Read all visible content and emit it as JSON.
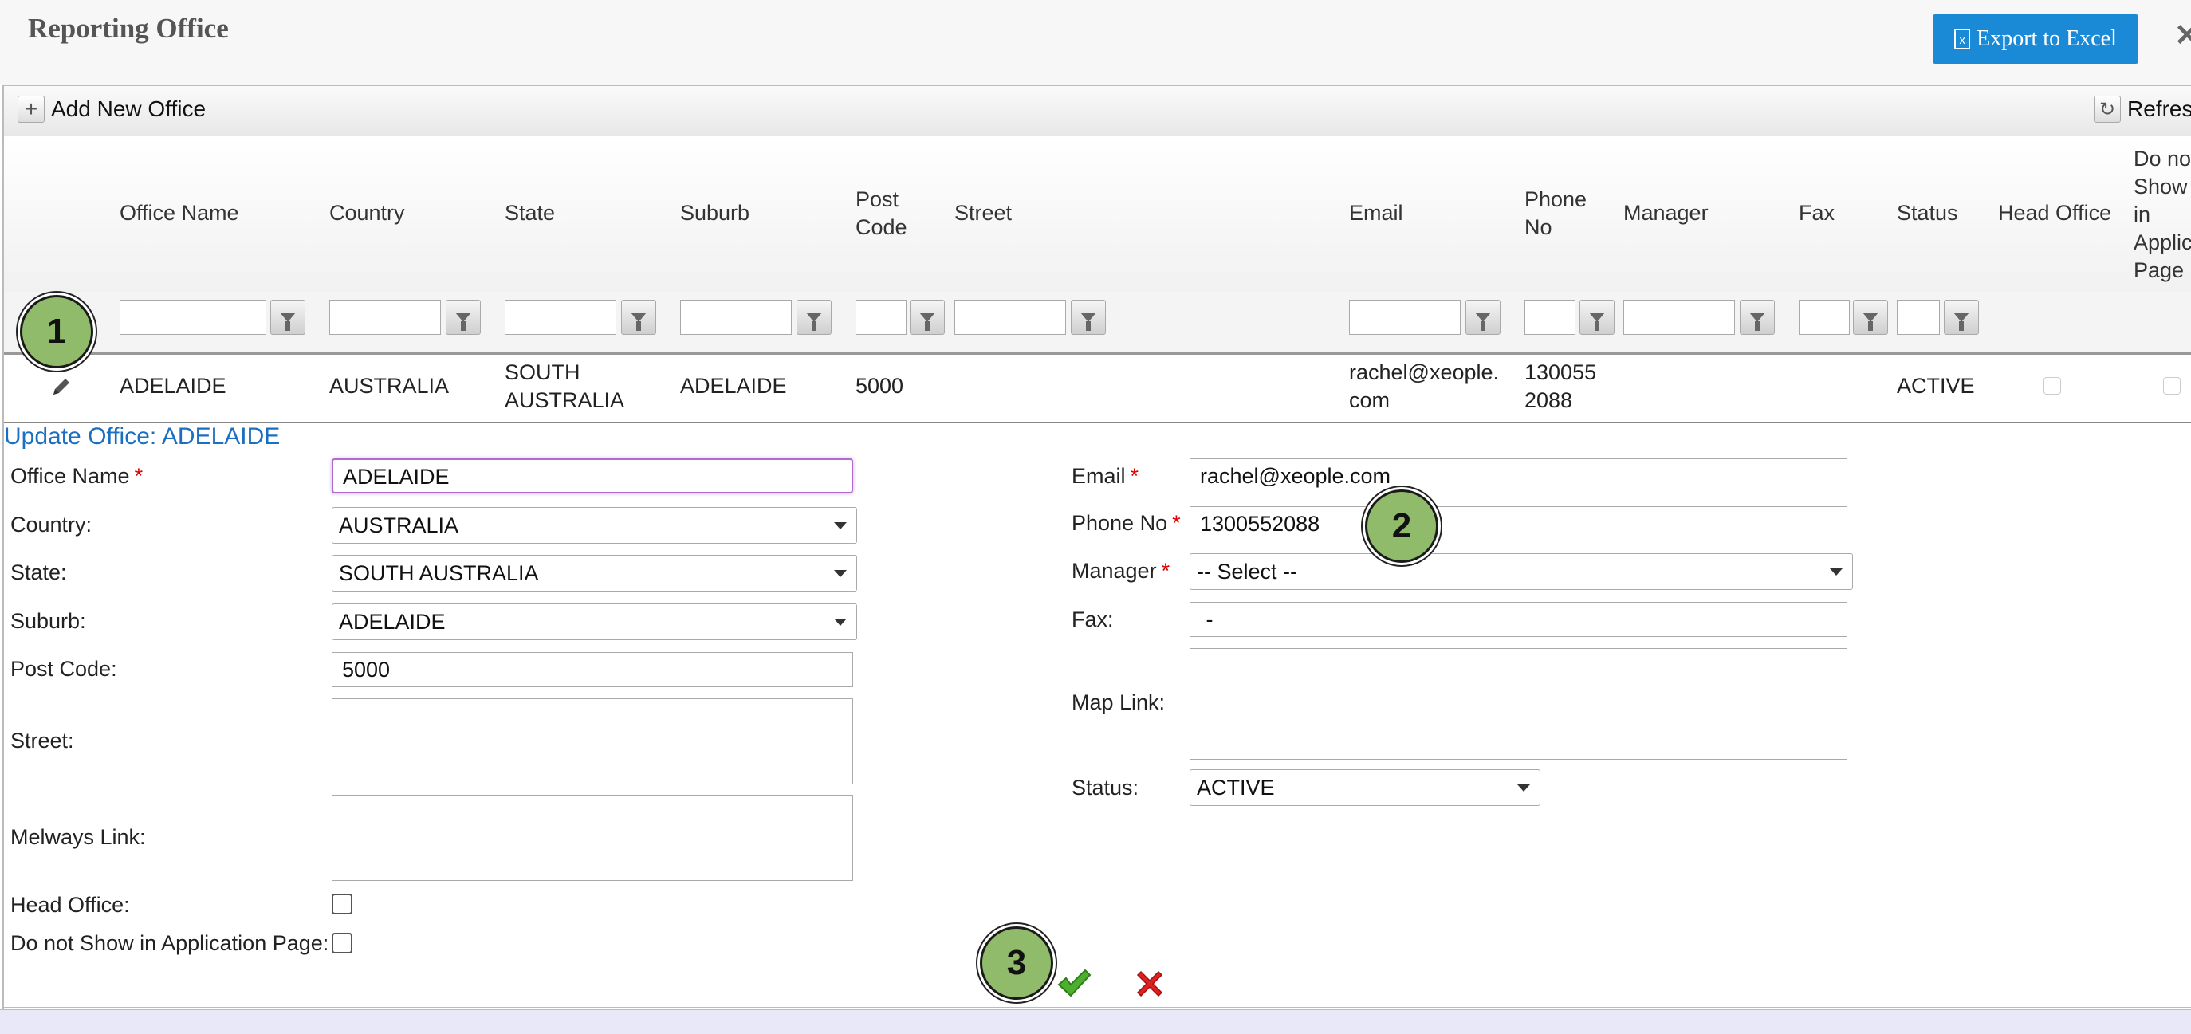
{
  "page": {
    "title": "Reporting Office"
  },
  "toolbar": {
    "export_label": "Export to Excel",
    "add_label": "Add New Office",
    "refresh_label": "Refres"
  },
  "grid": {
    "columns": {
      "office_name": "Office Name",
      "country": "Country",
      "state": "State",
      "suburb": "Suburb",
      "post_code_1": "Post",
      "post_code_2": "Code",
      "street": "Street",
      "email": "Email",
      "phone_1": "Phone",
      "phone_2": "No",
      "manager": "Manager",
      "fax": "Fax",
      "status": "Status",
      "head_office": "Head Office",
      "dns_1": "Do no",
      "dns_2": "Show",
      "dns_3": "in",
      "dns_4": "Applic",
      "dns_5": "Page"
    },
    "row": {
      "office_name": "ADELAIDE",
      "country": "AUSTRALIA",
      "state_1": "SOUTH",
      "state_2": "AUSTRALIA",
      "suburb": "ADELAIDE",
      "post_code": "5000",
      "email_1": "rachel@xeople.",
      "email_2": "com",
      "phone_1": "130055",
      "phone_2": "2088",
      "status": "ACTIVE"
    }
  },
  "form": {
    "title": "Update Office: ADELAIDE",
    "labels": {
      "office_name": "Office Name",
      "country": "Country:",
      "state": "State:",
      "suburb": "Suburb:",
      "post_code": "Post Code:",
      "street": "Street:",
      "melways": "Melways Link:",
      "head_office": "Head Office:",
      "dns": "Do not Show in Application Page:",
      "email": "Email",
      "phone": "Phone No",
      "manager": "Manager",
      "fax": "Fax:",
      "map_link": "Map Link:",
      "status": "Status:",
      "required_mark": "*"
    },
    "values": {
      "office_name": "ADELAIDE",
      "country": "AUSTRALIA",
      "state": "SOUTH AUSTRALIA",
      "suburb": "ADELAIDE",
      "post_code": "5000",
      "email": "rachel@xeople.com",
      "phone": "1300552088",
      "manager": "-- Select --",
      "fax": " -",
      "status": "ACTIVE"
    }
  },
  "badges": {
    "one": "1",
    "two": "2",
    "three": "3"
  },
  "icons": {
    "edit": "pencil-icon",
    "save": "checkmark-icon",
    "cancel": "x-icon",
    "filter": "funnel-icon",
    "add": "plus-icon",
    "refresh": "refresh-icon"
  },
  "colors": {
    "accent": "#1a8ad6",
    "link": "#1a6fc2",
    "badge": "#8fbb6a",
    "required": "#dd0000",
    "focus": "#b06ad0"
  }
}
